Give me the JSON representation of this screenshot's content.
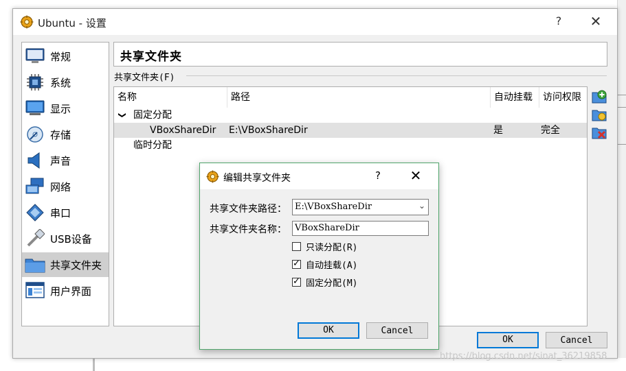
{
  "window": {
    "title": "Ubuntu - 设置",
    "help_glyph": "?",
    "close_glyph": "✕"
  },
  "sidebar": {
    "items": [
      {
        "label": "常规",
        "icon": "monitor-general-icon"
      },
      {
        "label": "系统",
        "icon": "chip-system-icon"
      },
      {
        "label": "显示",
        "icon": "display-icon"
      },
      {
        "label": "存储",
        "icon": "disc-storage-icon"
      },
      {
        "label": "声音",
        "icon": "speaker-icon"
      },
      {
        "label": "网络",
        "icon": "network-icon"
      },
      {
        "label": "串口",
        "icon": "serial-port-icon"
      },
      {
        "label": "USB设备",
        "icon": "usb-icon"
      },
      {
        "label": "共享文件夹",
        "icon": "folder-icon"
      },
      {
        "label": "用户界面",
        "icon": "user-interface-icon"
      }
    ],
    "active_index": 8
  },
  "header": {
    "title": "共享文件夹"
  },
  "group": {
    "label": "共享文件夹(F)"
  },
  "table": {
    "columns": [
      "名称",
      "路径",
      "自动挂载",
      "访问权限"
    ],
    "groups": [
      {
        "name": "固定分配",
        "expanded": true,
        "expander": "❯",
        "rows": [
          {
            "name": "VBoxShareDir",
            "path": "E:\\VBoxShareDir",
            "auto_mount": "是",
            "access": "完全"
          }
        ]
      },
      {
        "name": "临时分配",
        "rows": []
      }
    ]
  },
  "tools": [
    "add-folder-icon",
    "edit-folder-icon",
    "remove-folder-icon"
  ],
  "footer": {
    "ok_label": "OK",
    "cancel_label": "Cancel"
  },
  "dialog": {
    "title": "编辑共享文件夹",
    "help_glyph": "?",
    "close_glyph": "✕",
    "path_label": "共享文件夹路径：",
    "path_value": "E:\\VBoxShareDir",
    "name_label": "共享文件夹名称：",
    "name_value": "VBoxShareDir",
    "checkboxes": [
      {
        "label": "只读分配(R)",
        "checked": false
      },
      {
        "label": "自动挂载(A)",
        "checked": true
      },
      {
        "label": "固定分配(M)",
        "checked": true
      }
    ],
    "check_glyph": "✓",
    "ok_label": "OK",
    "cancel_label": "Cancel"
  },
  "watermark": "https://blog.csdn.net/sinat_36219858",
  "colors": {
    "dialog_border": "#4fa56b",
    "default_button_border": "#0078d7",
    "selection": "#e1e1e1"
  }
}
